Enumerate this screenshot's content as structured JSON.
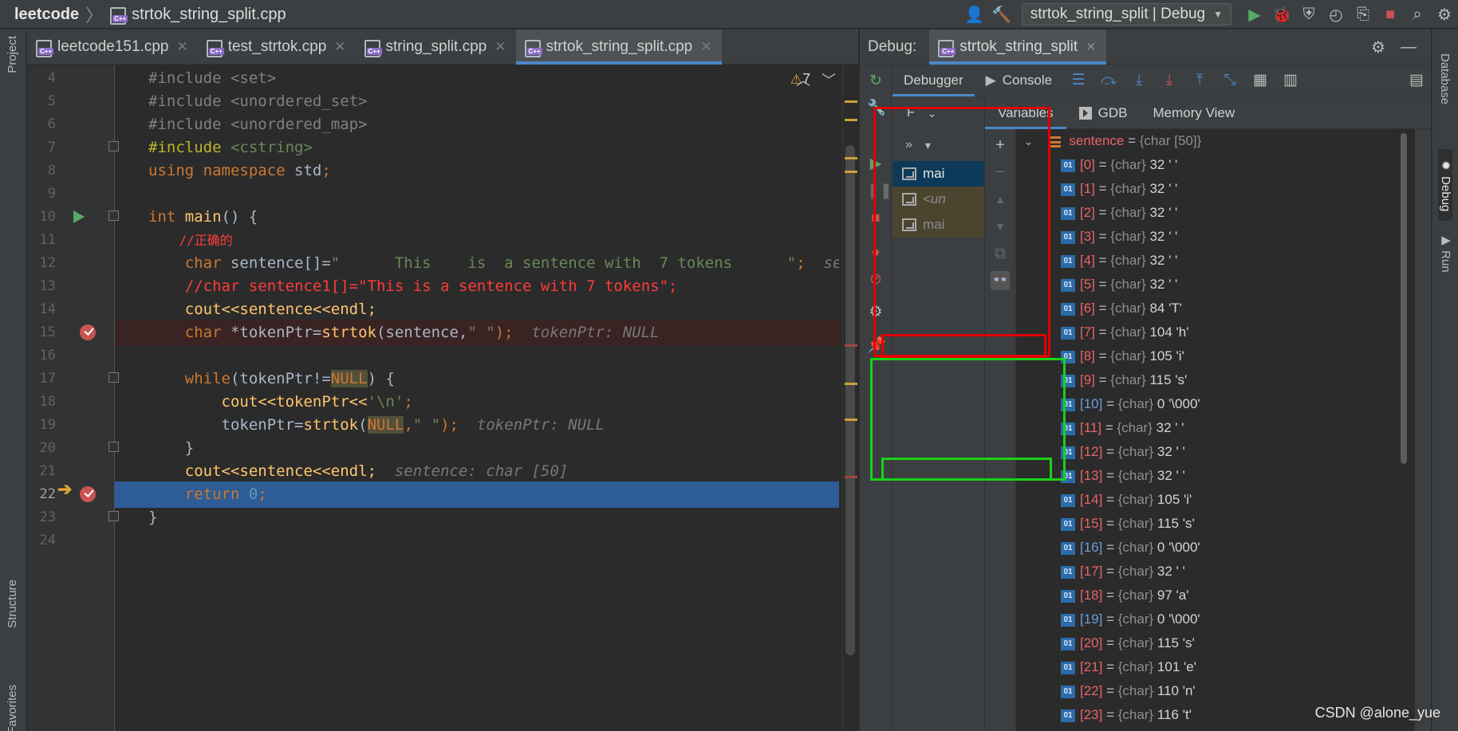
{
  "titlebar": {
    "project": "leetcode",
    "file": "strtok_string_split.cpp",
    "run_config": "strtok_string_split | Debug",
    "icons": [
      "user-icon",
      "hammer-icon",
      "run-icon",
      "debug-bug-icon",
      "coverage-icon",
      "profile-icon",
      "attach-icon",
      "stop-icon",
      "search-icon"
    ]
  },
  "left_stripe": {
    "project": "Project",
    "structure": "Structure",
    "favorites": "Favorites"
  },
  "right_stripe": {
    "database": "Database",
    "debug": "Debug",
    "run": "Run"
  },
  "editor_tabs": [
    {
      "label": "leetcode151.cpp",
      "active": false
    },
    {
      "label": "test_strtok.cpp",
      "active": false
    },
    {
      "label": "string_split.cpp",
      "active": false
    },
    {
      "label": "strtok_string_split.cpp",
      "active": true
    }
  ],
  "editor": {
    "warnings": "7",
    "lines": {
      "l4": {
        "num": "4",
        "a": "#include ",
        "b": "<set>"
      },
      "l5": {
        "num": "5",
        "a": "#include ",
        "b": "<unordered_set>"
      },
      "l6": {
        "num": "6",
        "a": "#include ",
        "b": "<unordered_map>"
      },
      "l7": {
        "num": "7",
        "a": "#include ",
        "b": "<cstring>"
      },
      "l8": {
        "num": "8",
        "a": "using namespace ",
        "b": "std",
        "c": ";"
      },
      "l9": {
        "num": "9"
      },
      "l10": {
        "num": "10",
        "a": "int ",
        "b": "main",
        "c": "() {"
      },
      "l11": {
        "num": "11",
        "a": "    //正确的"
      },
      "l12": {
        "num": "12",
        "a": "    char ",
        "b": "sentence[]=",
        "c": "\"      This    is  a sentence with  7 tokens      \"",
        "d": ";  ",
        "e": "sen"
      },
      "l13": {
        "num": "13",
        "a": "    //char sentence1[]=\"This is a sentence with 7 tokens\";"
      },
      "l14": {
        "num": "14",
        "a": "    cout<<sentence<<endl;"
      },
      "l15": {
        "num": "15",
        "a": "    char ",
        "b": "*tokenPtr=",
        "c": "strtok",
        "d": "(sentence,",
        "e": "\" \"",
        "f": ");  ",
        "g": "tokenPtr: NULL"
      },
      "l16": {
        "num": "16"
      },
      "l17": {
        "num": "17",
        "a": "    while",
        "b": "(tokenPtr!=",
        "c": "NULL",
        "d": ") {"
      },
      "l18": {
        "num": "18",
        "a": "        cout<<tokenPtr<<",
        "b": "'\\n'",
        "c": ";"
      },
      "l19": {
        "num": "19",
        "a": "        tokenPtr=",
        "b": "strtok",
        "c": "(",
        "d": "NULL",
        ",": ",",
        "e": "\" \"",
        "f": ");  ",
        "g": "tokenPtr: NULL"
      },
      "l20": {
        "num": "20",
        "a": "    }"
      },
      "l21": {
        "num": "21",
        "a": "    cout<<sentence<<endl;  ",
        "b": "sentence: char [50]"
      },
      "l22": {
        "num": "22",
        "a": "    return ",
        "b": "0",
        "c": ";"
      },
      "l23": {
        "num": "23",
        "a": "}"
      },
      "l24": {
        "num": "24"
      }
    }
  },
  "debug": {
    "label": "Debug:",
    "session": "strtok_string_split",
    "subtabs": {
      "debugger": "Debugger",
      "console": "Console"
    },
    "frames_filter": "F",
    "frames": [
      {
        "label": "mai",
        "style": "sel"
      },
      {
        "label": "<un",
        "style": "dim"
      },
      {
        "label": "mai",
        "style": "dim2"
      }
    ],
    "var_tabs": {
      "variables": "Variables",
      "gdb": "GDB",
      "memory": "Memory View"
    },
    "root": {
      "name": "sentence",
      "eq": " = ",
      "type": "{char [50]}"
    },
    "items": [
      {
        "idx": "[0]",
        "type": "{char}",
        "val": "32 ' '"
      },
      {
        "idx": "[1]",
        "type": "{char}",
        "val": "32 ' '"
      },
      {
        "idx": "[2]",
        "type": "{char}",
        "val": "32 ' '"
      },
      {
        "idx": "[3]",
        "type": "{char}",
        "val": "32 ' '"
      },
      {
        "idx": "[4]",
        "type": "{char}",
        "val": "32 ' '"
      },
      {
        "idx": "[5]",
        "type": "{char}",
        "val": "32 ' '"
      },
      {
        "idx": "[6]",
        "type": "{char}",
        "val": "84 'T'"
      },
      {
        "idx": "[7]",
        "type": "{char}",
        "val": "104 'h'"
      },
      {
        "idx": "[8]",
        "type": "{char}",
        "val": "105 'i'"
      },
      {
        "idx": "[9]",
        "type": "{char}",
        "val": "115 's'"
      },
      {
        "idx": "[10]",
        "type": "{char}",
        "val": "0 '\\000'",
        "changed": true
      },
      {
        "idx": "[11]",
        "type": "{char}",
        "val": "32 ' '"
      },
      {
        "idx": "[12]",
        "type": "{char}",
        "val": "32 ' '"
      },
      {
        "idx": "[13]",
        "type": "{char}",
        "val": "32 ' '"
      },
      {
        "idx": "[14]",
        "type": "{char}",
        "val": "105 'i'"
      },
      {
        "idx": "[15]",
        "type": "{char}",
        "val": "115 's'"
      },
      {
        "idx": "[16]",
        "type": "{char}",
        "val": "0 '\\000'",
        "changed": true
      },
      {
        "idx": "[17]",
        "type": "{char}",
        "val": "32 ' '"
      },
      {
        "idx": "[18]",
        "type": "{char}",
        "val": "97 'a'"
      },
      {
        "idx": "[19]",
        "type": "{char}",
        "val": "0 '\\000'",
        "changed": true
      },
      {
        "idx": "[20]",
        "type": "{char}",
        "val": "115 's'"
      },
      {
        "idx": "[21]",
        "type": "{char}",
        "val": "101 'e'"
      },
      {
        "idx": "[22]",
        "type": "{char}",
        "val": "110 'n'"
      },
      {
        "idx": "[23]",
        "type": "{char}",
        "val": "116 't'"
      }
    ],
    "highlight_colors": {
      "red": "#e30000",
      "green": "#17d317"
    }
  },
  "watermark": "CSDN @alone_yue"
}
